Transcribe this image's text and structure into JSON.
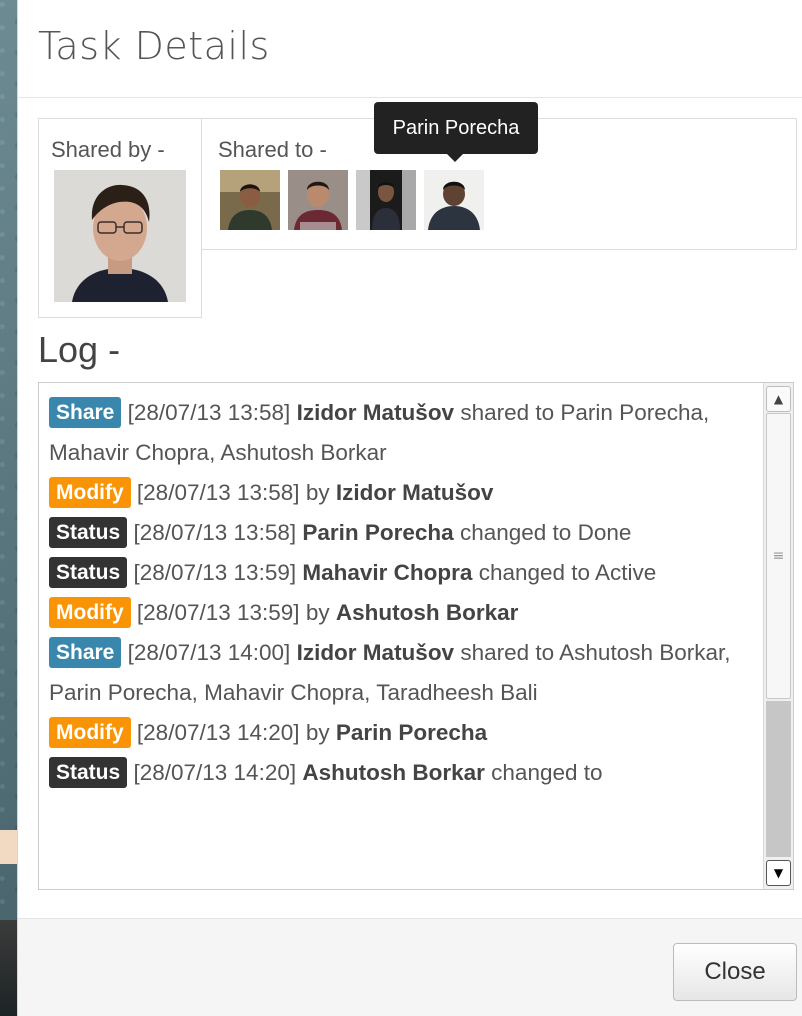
{
  "modal": {
    "title": "Task Details",
    "shared_by_label": "Shared by -",
    "shared_to_label": "Shared to -",
    "tooltip": "Parin Porecha",
    "log_title": "Log -"
  },
  "log": [
    {
      "badge": "Share",
      "type": "share",
      "time": "[28/07/13 13:58]",
      "actor": "Izidor Matušov",
      "text": "shared to Parin Porecha, Mahavir Chopra, Ashutosh Borkar"
    },
    {
      "badge": "Modify",
      "type": "modify",
      "time": "[28/07/13 13:58]",
      "prefix": "by",
      "actor": "Izidor Matušov",
      "text": ""
    },
    {
      "badge": "Status",
      "type": "status",
      "time": "[28/07/13 13:58]",
      "actor": "Parin Porecha",
      "text": "changed to Done"
    },
    {
      "badge": "Status",
      "type": "status",
      "time": "[28/07/13 13:59]",
      "actor": "Mahavir Chopra",
      "text": "changed to Active"
    },
    {
      "badge": "Modify",
      "type": "modify",
      "time": "[28/07/13 13:59]",
      "prefix": "by",
      "actor": "Ashutosh Borkar",
      "text": ""
    },
    {
      "badge": "Share",
      "type": "share",
      "time": "[28/07/13 14:00]",
      "actor": "Izidor Matušov",
      "text": "shared to Ashutosh Borkar, Parin Porecha, Mahavir Chopra, Taradheesh Bali"
    },
    {
      "badge": "Modify",
      "type": "modify",
      "time": "[28/07/13 14:20]",
      "prefix": "by",
      "actor": "Parin Porecha",
      "text": ""
    },
    {
      "badge": "Status",
      "type": "status",
      "time": "[28/07/13 14:20]",
      "actor": "Ashutosh Borkar",
      "text": "changed to"
    }
  ],
  "footer": {
    "close_label": "Close"
  },
  "icons": {
    "scroll_up": "scroll-up-arrow-icon",
    "scroll_down": "scroll-down-arrow-icon",
    "grip": "scroll-grip-icon"
  },
  "colors": {
    "share": "#3a87ad",
    "modify": "#f89406",
    "status": "#333333"
  }
}
